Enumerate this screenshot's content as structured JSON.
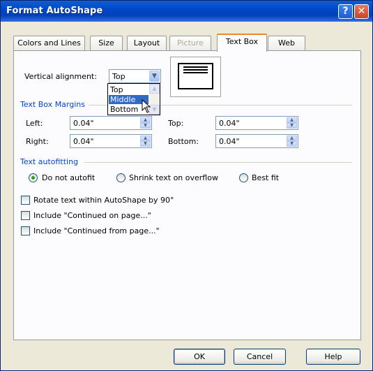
{
  "window": {
    "title": "Format AutoShape",
    "help_glyph": "?",
    "close_glyph": "✕"
  },
  "tabs": [
    {
      "label": "Colors and Lines",
      "state": "normal"
    },
    {
      "label": "Size",
      "state": "normal"
    },
    {
      "label": "Layout",
      "state": "normal"
    },
    {
      "label": "Picture",
      "state": "disabled"
    },
    {
      "label": "Text Box",
      "state": "active"
    },
    {
      "label": "Web",
      "state": "normal"
    }
  ],
  "vertical_alignment": {
    "label": "Vertical alignment:",
    "value": "Top",
    "options": [
      "Top",
      "Middle",
      "Bottom"
    ],
    "highlighted": "Middle"
  },
  "margins": {
    "title": "Text Box Margins",
    "left_label": "Left:",
    "left_value": "0.04\"",
    "right_label": "Right:",
    "right_value": "0.04\"",
    "top_label": "Top:",
    "top_value": "0.04\"",
    "bottom_label": "Bottom:",
    "bottom_value": "0.04\""
  },
  "autofit": {
    "title": "Text autofitting",
    "options": [
      "Do not autofit",
      "Shrink text on overflow",
      "Best fit"
    ],
    "selected": "Do not autofit"
  },
  "checkboxes": [
    {
      "label": "Rotate text within AutoShape by 90°",
      "checked": false
    },
    {
      "label": "Include \"Continued on page...\"",
      "checked": false
    },
    {
      "label": "Include \"Continued from page...\"",
      "checked": false
    }
  ],
  "buttons": {
    "ok": "OK",
    "cancel": "Cancel",
    "help": "Help"
  },
  "colors": {
    "titlebar": "#0047c8",
    "group_title": "#0046d5",
    "active_tab_accent": "#e68b2c",
    "selection": "#316ac5"
  }
}
